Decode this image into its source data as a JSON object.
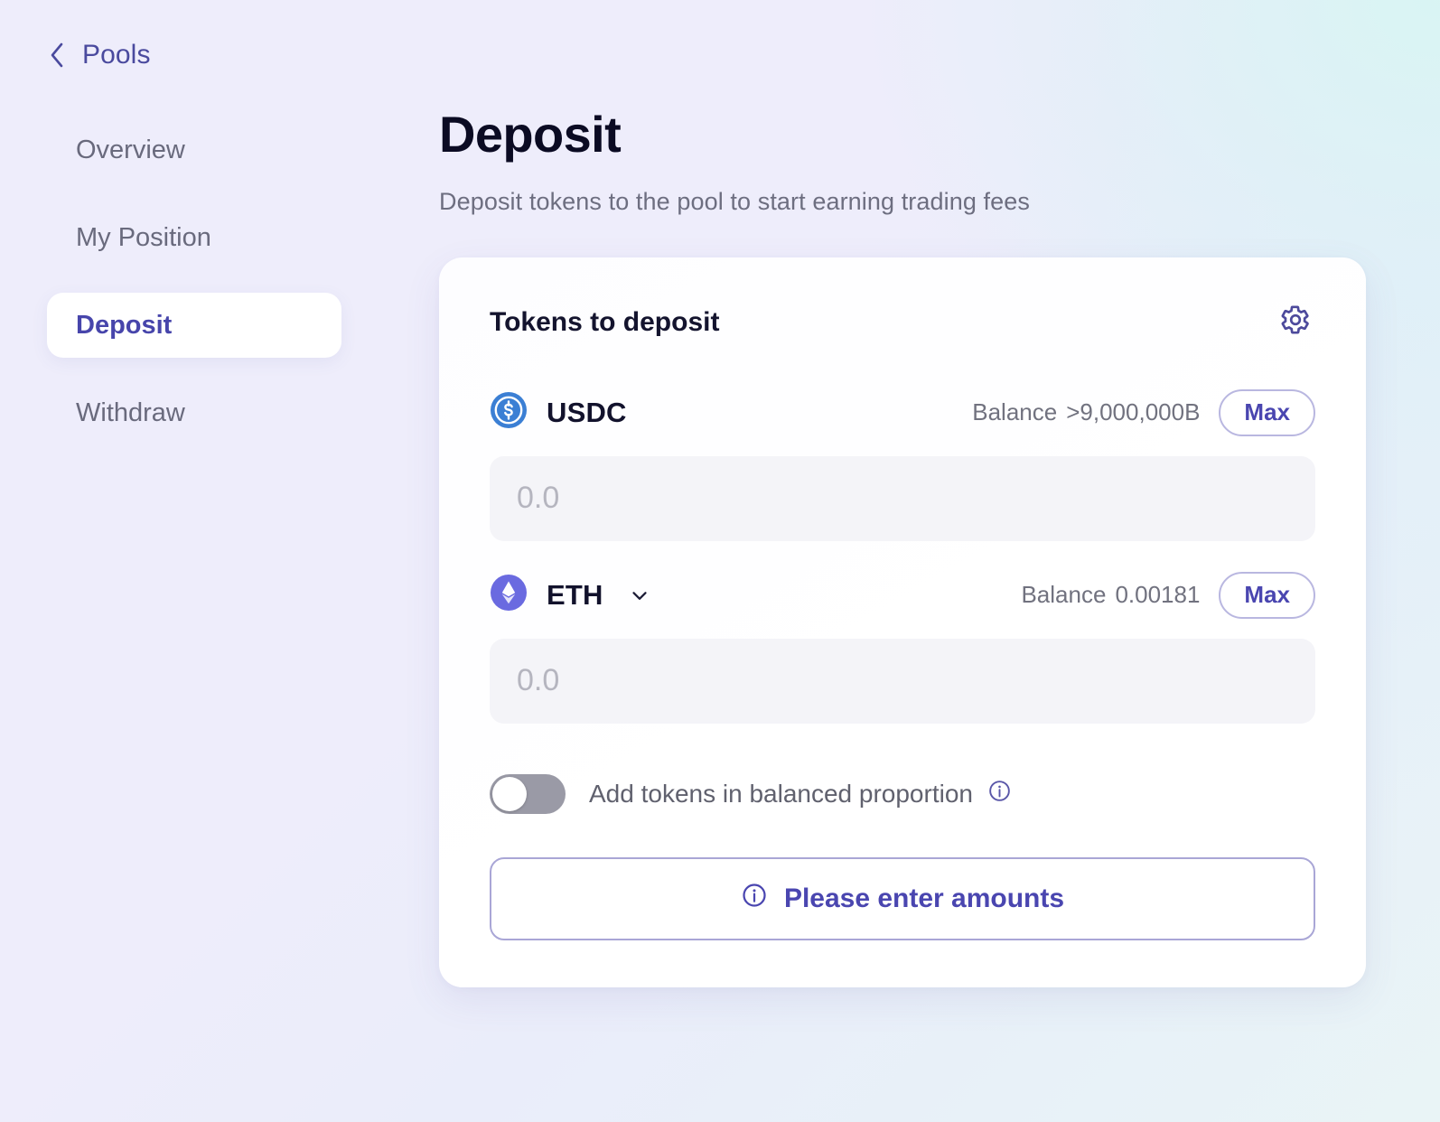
{
  "sidebar": {
    "back": {
      "label": "Pools",
      "icon": "chevron-left-icon"
    },
    "items": [
      {
        "label": "Overview",
        "active": false
      },
      {
        "label": "My Position",
        "active": false
      },
      {
        "label": "Deposit",
        "active": true
      },
      {
        "label": "Withdraw",
        "active": false
      }
    ]
  },
  "page": {
    "title": "Deposit",
    "subtitle": "Deposit tokens to the pool to start earning trading fees"
  },
  "card": {
    "title": "Tokens to deposit",
    "settings_icon": "gear-icon",
    "tokens": [
      {
        "symbol": "USDC",
        "icon": "usdc-token-icon",
        "has_dropdown": false,
        "balance_label": "Balance",
        "balance_value": ">9,000,000B",
        "max_label": "Max",
        "amount_value": "",
        "amount_placeholder": "0.0"
      },
      {
        "symbol": "ETH",
        "icon": "eth-token-icon",
        "has_dropdown": true,
        "balance_label": "Balance",
        "balance_value": "0.00181",
        "max_label": "Max",
        "amount_value": "",
        "amount_placeholder": "0.0"
      }
    ],
    "balanced_toggle": {
      "label": "Add tokens in balanced proportion",
      "checked": false,
      "info_icon": "info-icon"
    },
    "cta": {
      "label": "Please enter amounts",
      "icon": "info-icon",
      "disabled": true
    }
  },
  "colors": {
    "accent": "#4a46b0",
    "accent_soft": "#a9a6d6",
    "title": "#0b0b23",
    "muted": "#6d6e80",
    "usdc": "#3b7fd4",
    "eth": "#6a6ae0",
    "card_bg": "#ffffff",
    "input_bg": "#f4f4f8"
  }
}
